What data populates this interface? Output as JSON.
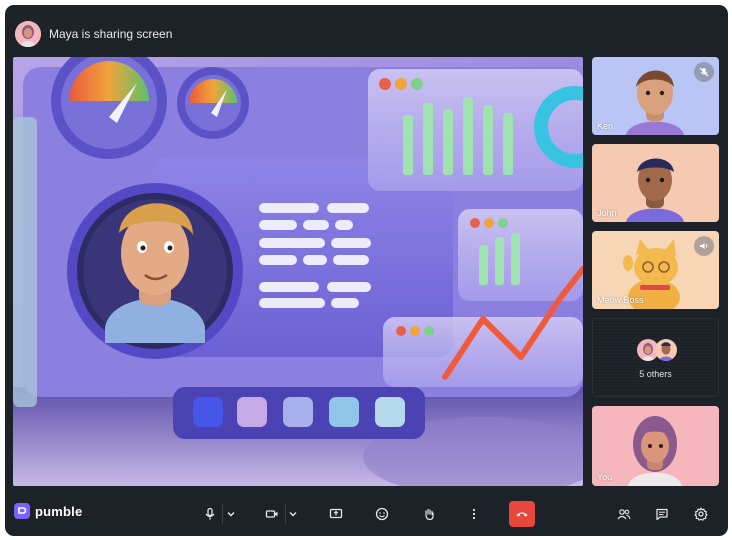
{
  "header": {
    "sharing_text": "Maya is sharing screen"
  },
  "participants": [
    {
      "name": "Ken",
      "status_icon": "mic-off-icon",
      "bg": "#b9c6f5"
    },
    {
      "name": "John",
      "status_icon": "",
      "bg": "#f6c9b3"
    },
    {
      "name": "Meow Boss",
      "status_icon": "speaker-icon",
      "bg": "#f7d6b6"
    },
    {
      "name": "You",
      "status_icon": "",
      "bg": "#f5b7bb"
    }
  ],
  "others": {
    "label": "5 others"
  },
  "brand": {
    "name": "pumble"
  },
  "colors": {
    "app_bg": "#1c2227",
    "end_call": "#e8483c",
    "brand": "#7b61ff"
  },
  "controls": [
    "mic-icon",
    "chevron-down-icon",
    "camera-icon",
    "chevron-down-icon",
    "share-screen-icon",
    "emoji-icon",
    "raise-hand-icon",
    "more-icon",
    "end-call-icon",
    "participants-icon",
    "chat-icon",
    "settings-icon"
  ]
}
